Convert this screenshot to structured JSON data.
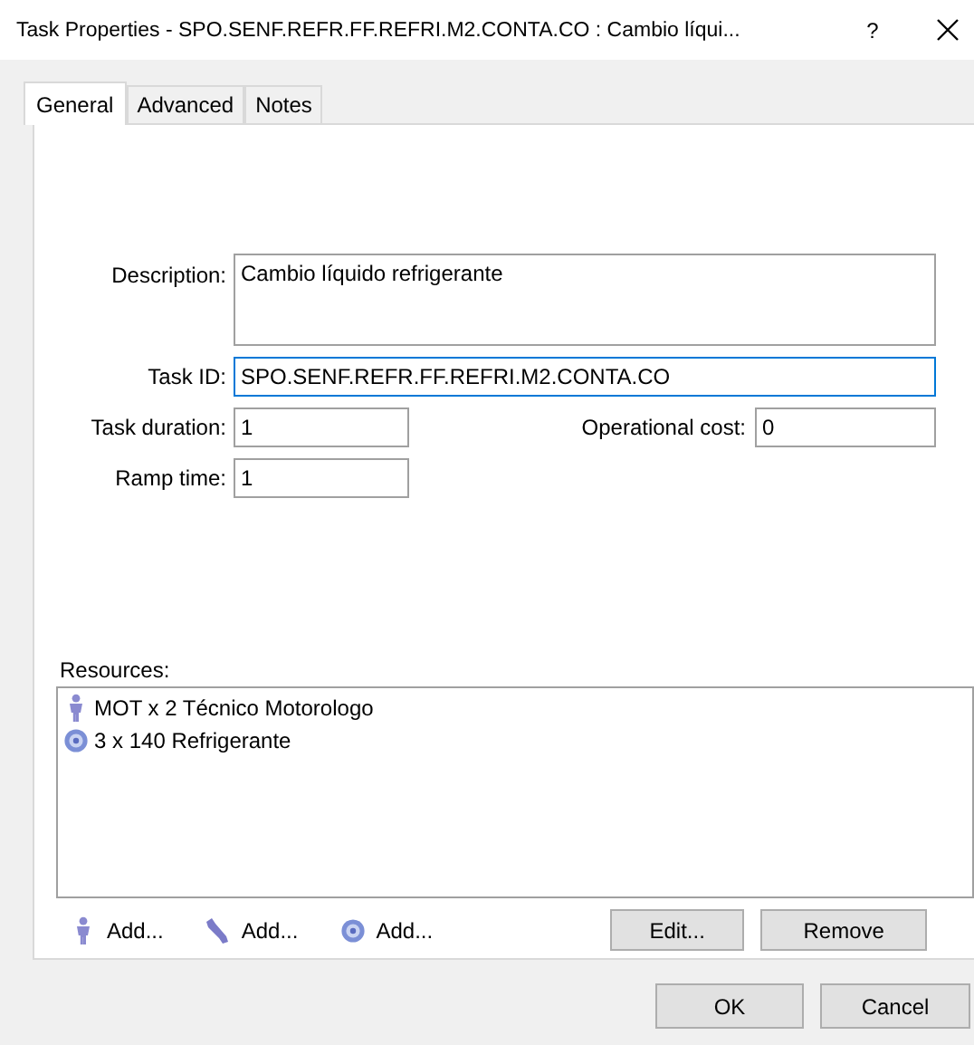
{
  "window": {
    "title": "Task Properties - SPO.SENF.REFR.FF.REFRI.M2.CONTA.CO : Cambio líqui...",
    "help": "?"
  },
  "tabs": [
    {
      "label": "General",
      "selected": true
    },
    {
      "label": "Advanced",
      "selected": false
    },
    {
      "label": "Notes",
      "selected": false
    }
  ],
  "description": {
    "label": "Description:",
    "value": "Cambio líquido refrigerante"
  },
  "task_id": {
    "label": "Task ID:",
    "value": "SPO.SENF.REFR.FF.REFRI.M2.CONTA.CO",
    "focused": true
  },
  "task_duration": {
    "label": "Task duration:",
    "value": "1"
  },
  "operational_cost": {
    "label": "Operational cost:",
    "value": "0"
  },
  "ramp_time": {
    "label": "Ramp time:",
    "value": "1"
  },
  "resources": {
    "label": "Resources:",
    "items": [
      {
        "kind": "person",
        "text": "MOT x 2 Técnico Motorologo"
      },
      {
        "kind": "material",
        "text": "3 x 140 Refrigerante"
      }
    ]
  },
  "add_buttons": [
    {
      "kind": "person",
      "label": "Add..."
    },
    {
      "kind": "tool",
      "label": "Add..."
    },
    {
      "kind": "material",
      "label": "Add..."
    }
  ],
  "edit_button": "Edit...",
  "remove_button": "Remove",
  "buttons": [
    "OK",
    "Cancel"
  ]
}
